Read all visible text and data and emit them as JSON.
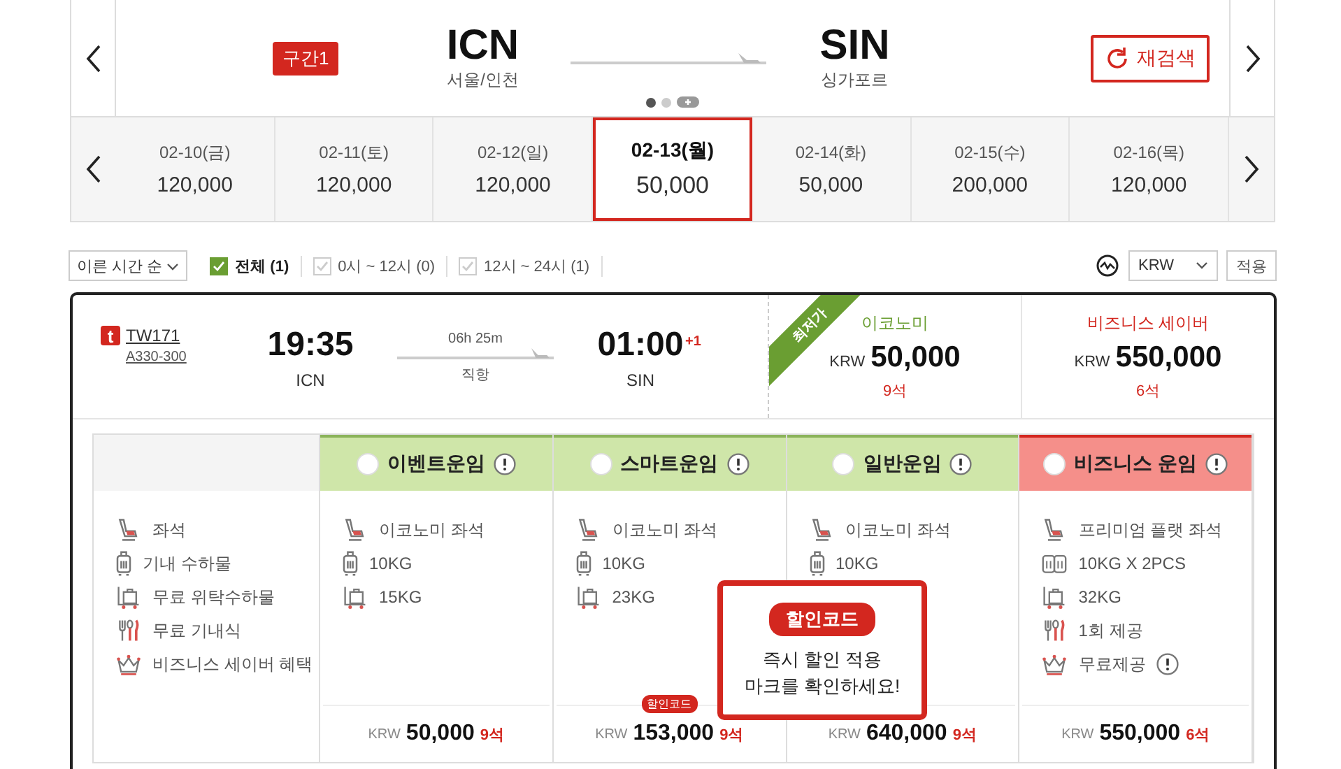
{
  "segment": {
    "badge": "구간1",
    "from": {
      "code": "ICN",
      "city": "서울/인천"
    },
    "to": {
      "code": "SIN",
      "city": "싱가포르"
    },
    "research": "재검색",
    "slides": [
      {
        "selected": true
      },
      {
        "selected": false
      }
    ]
  },
  "dates": [
    {
      "date": "02-10(금)",
      "price": "120,000",
      "selected": false
    },
    {
      "date": "02-11(토)",
      "price": "120,000",
      "selected": false
    },
    {
      "date": "02-12(일)",
      "price": "120,000",
      "selected": false
    },
    {
      "date": "02-13(월)",
      "price": "50,000",
      "selected": true
    },
    {
      "date": "02-14(화)",
      "price": "50,000",
      "selected": false
    },
    {
      "date": "02-15(수)",
      "price": "200,000",
      "selected": false
    },
    {
      "date": "02-16(목)",
      "price": "120,000",
      "selected": false
    }
  ],
  "filters": {
    "sort": "이른 시간 순",
    "checks": [
      {
        "label": "전체 (1)",
        "checked": true
      },
      {
        "label": "0시 ~ 12시 (0)",
        "checked": false
      },
      {
        "label": "12시 ~ 24시 (1)",
        "checked": false
      }
    ],
    "currency": "KRW",
    "apply": "적용"
  },
  "flight": {
    "logo": "t",
    "number": "TW171",
    "aircraft": "A330-300",
    "depart": {
      "time": "19:35",
      "code": "ICN"
    },
    "duration": "06h 25m",
    "stops": "직항",
    "arrive": {
      "time": "01:00",
      "day_offset": "+1",
      "code": "SIN"
    },
    "cabins": [
      {
        "kind": "economy",
        "ribbon": "최저가",
        "name": "이코노미",
        "currency": "KRW",
        "price": "50,000",
        "seats": "9석"
      },
      {
        "kind": "business",
        "name": "비즈니스 세이버",
        "currency": "KRW",
        "price": "550,000",
        "seats": "6석"
      }
    ]
  },
  "fare_table": {
    "labels": [
      {
        "kind": "seat",
        "text": "좌석"
      },
      {
        "kind": "bag",
        "text": "기내 수하물"
      },
      {
        "kind": "cart",
        "text": "무료 위탁수하물"
      },
      {
        "kind": "meal",
        "text": "무료 기내식"
      },
      {
        "kind": "crown",
        "text": "비즈니스 세이버 혜택"
      }
    ],
    "fares": [
      {
        "kind": "economy",
        "name": "이벤트운임",
        "selected": false,
        "features": [
          {
            "kind": "seat",
            "text": "이코노미 좌석"
          },
          {
            "kind": "bag",
            "text": "10KG"
          },
          {
            "kind": "cart",
            "text": "15KG"
          }
        ],
        "currency": "KRW",
        "price": "50,000",
        "seats": "9석"
      },
      {
        "kind": "economy",
        "name": "스마트운임",
        "selected": false,
        "features": [
          {
            "kind": "seat",
            "text": "이코노미 좌석"
          },
          {
            "kind": "bag",
            "text": "10KG"
          },
          {
            "kind": "cart",
            "text": "23KG"
          }
        ],
        "badge": "할인코드",
        "currency": "KRW",
        "price": "153,000",
        "seats": "9석"
      },
      {
        "kind": "economy",
        "name": "일반운임",
        "selected": false,
        "features": [
          {
            "kind": "seat",
            "text": "이코노미 좌석"
          },
          {
            "kind": "bag",
            "text": "10KG"
          }
        ],
        "currency": "KRW",
        "price": "640,000",
        "seats": "9석"
      },
      {
        "kind": "business",
        "name": "비즈니스 운임",
        "selected": false,
        "features": [
          {
            "kind": "seat",
            "text": "프리미엄 플랫 좌석"
          },
          {
            "kind": "bag2",
            "text": "10KG X 2PCS"
          },
          {
            "kind": "cart",
            "text": "32KG"
          },
          {
            "kind": "meal",
            "text": "1회 제공"
          },
          {
            "kind": "crown",
            "text": "무료제공",
            "info": true
          }
        ],
        "currency": "KRW",
        "price": "550,000",
        "seats": "6석"
      }
    ]
  },
  "popup": {
    "badge": "할인코드",
    "text": "즉시 할인 적용\n마크를 확인하세요!"
  }
}
